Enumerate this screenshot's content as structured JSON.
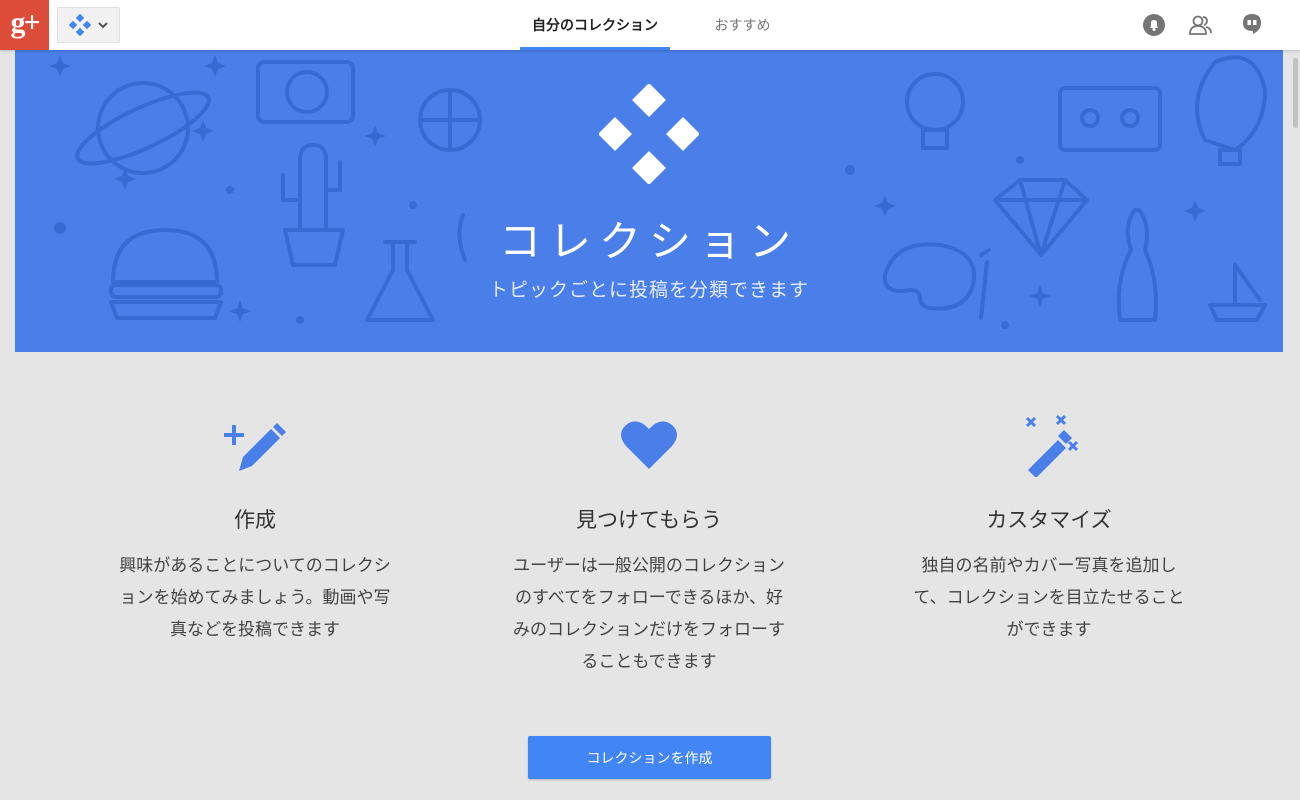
{
  "header": {
    "logo_text": "g+",
    "tabs": [
      {
        "label": "自分のコレクション",
        "active": true
      },
      {
        "label": "おすすめ",
        "active": false
      }
    ],
    "icons": [
      "notifications-icon",
      "people-icon",
      "hangouts-icon"
    ]
  },
  "hero": {
    "title": "コレクション",
    "subtitle": "トピックごとに投稿を分類できます"
  },
  "features": [
    {
      "icon": "create-icon",
      "title": "作成",
      "lines": [
        "興味があることについてのコレクシ",
        "ョンを始めてみましょう。動画や写",
        "真などを投稿できます"
      ]
    },
    {
      "icon": "heart-icon",
      "title": "見つけてもらう",
      "lines": [
        "ユーザーは一般公開のコレクション",
        "のすべてをフォローできるほか、好",
        "みのコレクションだけをフォローす",
        "ることもできます"
      ]
    },
    {
      "icon": "magic-wand-icon",
      "title": "カスタマイズ",
      "lines": [
        "独自の名前やカバー写真を追加し",
        "て、コレクションを目立たせること",
        "ができます"
      ]
    }
  ],
  "cta": {
    "label": "コレクションを作成"
  },
  "colors": {
    "brand_red": "#dd4b39",
    "hero_blue": "#4a7fe9",
    "accent_blue": "#4285f4",
    "background": "#e5e5e5"
  }
}
